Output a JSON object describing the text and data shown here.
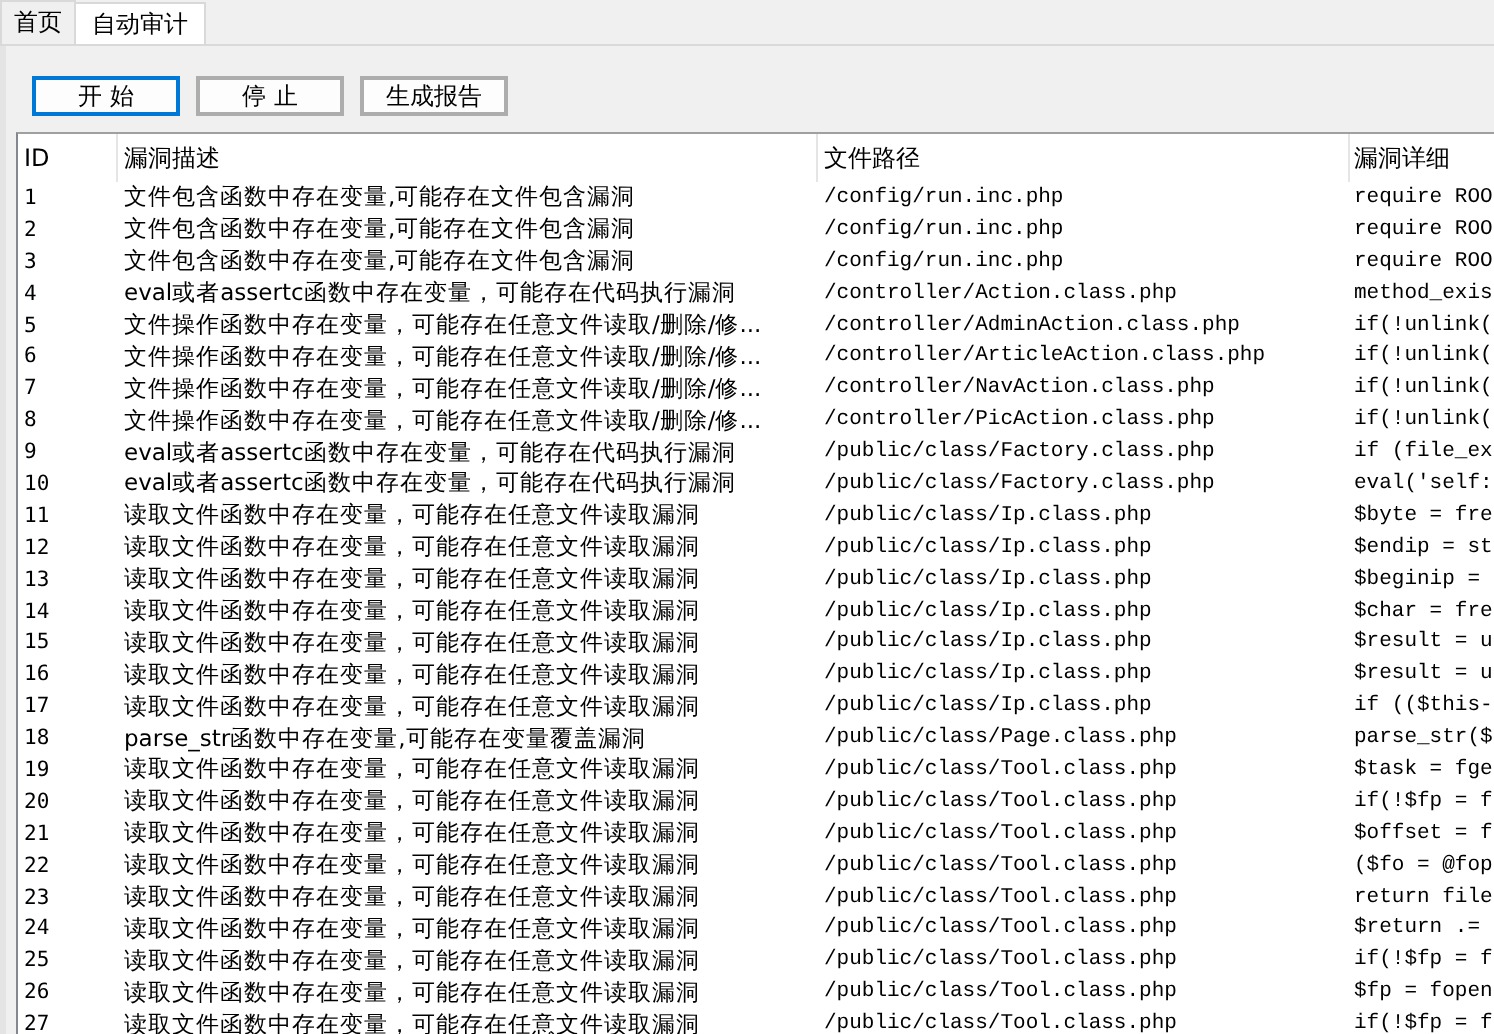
{
  "tabs": [
    {
      "label": "首页",
      "selected": false
    },
    {
      "label": "自动审计",
      "selected": true
    }
  ],
  "buttons": [
    {
      "label": "开 始",
      "selected": true
    },
    {
      "label": "停 止",
      "selected": false
    },
    {
      "label": "生成报告",
      "selected": false
    }
  ],
  "table": {
    "columns": [
      "ID",
      "漏洞描述",
      "文件路径",
      "漏洞详细"
    ],
    "rows": [
      [
        "1",
        "文件包含函数中存在变量,可能存在文件包含漏洞",
        "/config/run.inc.php",
        "require ROO"
      ],
      [
        "2",
        "文件包含函数中存在变量,可能存在文件包含漏洞",
        "/config/run.inc.php",
        "require ROO"
      ],
      [
        "3",
        "文件包含函数中存在变量,可能存在文件包含漏洞",
        "/config/run.inc.php",
        "require ROO"
      ],
      [
        "4",
        "eval或者assertc函数中存在变量，可能存在代码执行漏洞",
        "/controller/Action.class.php",
        "method_exis"
      ],
      [
        "5",
        "文件操作函数中存在变量，可能存在任意文件读取/删除/修...",
        "/controller/AdminAction.class.php",
        "if(!unlink("
      ],
      [
        "6",
        "文件操作函数中存在变量，可能存在任意文件读取/删除/修...",
        "/controller/ArticleAction.class.php",
        "if(!unlink("
      ],
      [
        "7",
        "文件操作函数中存在变量，可能存在任意文件读取/删除/修...",
        "/controller/NavAction.class.php",
        "if(!unlink("
      ],
      [
        "8",
        "文件操作函数中存在变量，可能存在任意文件读取/删除/修...",
        "/controller/PicAction.class.php",
        "if(!unlink("
      ],
      [
        "9",
        "eval或者assertc函数中存在变量，可能存在代码执行漏洞",
        "/public/class/Factory.class.php",
        "if (file_ex"
      ],
      [
        "10",
        "eval或者assertc函数中存在变量，可能存在代码执行漏洞",
        "/public/class/Factory.class.php",
        "eval('self:"
      ],
      [
        "11",
        "读取文件函数中存在变量，可能存在任意文件读取漏洞",
        "/public/class/Ip.class.php",
        "$byte = fre"
      ],
      [
        "12",
        "读取文件函数中存在变量，可能存在任意文件读取漏洞",
        "/public/class/Ip.class.php",
        "$endip = st"
      ],
      [
        "13",
        "读取文件函数中存在变量，可能存在任意文件读取漏洞",
        "/public/class/Ip.class.php",
        "$beginip ="
      ],
      [
        "14",
        "读取文件函数中存在变量，可能存在任意文件读取漏洞",
        "/public/class/Ip.class.php",
        "$char = fre"
      ],
      [
        "15",
        "读取文件函数中存在变量，可能存在任意文件读取漏洞",
        "/public/class/Ip.class.php",
        "$result = u"
      ],
      [
        "16",
        "读取文件函数中存在变量，可能存在任意文件读取漏洞",
        "/public/class/Ip.class.php",
        "$result = u"
      ],
      [
        "17",
        "读取文件函数中存在变量，可能存在任意文件读取漏洞",
        "/public/class/Ip.class.php",
        "if (($this-"
      ],
      [
        "18",
        "parse_str函数中存在变量,可能存在变量覆盖漏洞",
        "/public/class/Page.class.php",
        "parse_str($"
      ],
      [
        "19",
        "读取文件函数中存在变量，可能存在任意文件读取漏洞",
        "/public/class/Tool.class.php",
        "$task = fge"
      ],
      [
        "20",
        "读取文件函数中存在变量，可能存在任意文件读取漏洞",
        "/public/class/Tool.class.php",
        "if(!$fp = f"
      ],
      [
        "21",
        "读取文件函数中存在变量，可能存在任意文件读取漏洞",
        "/public/class/Tool.class.php",
        "$offset = f"
      ],
      [
        "22",
        "读取文件函数中存在变量，可能存在任意文件读取漏洞",
        "/public/class/Tool.class.php",
        "($fo = @fop"
      ],
      [
        "23",
        "读取文件函数中存在变量，可能存在任意文件读取漏洞",
        "/public/class/Tool.class.php",
        "return file"
      ],
      [
        "24",
        "读取文件函数中存在变量，可能存在任意文件读取漏洞",
        "/public/class/Tool.class.php",
        "$return .="
      ],
      [
        "25",
        "读取文件函数中存在变量，可能存在任意文件读取漏洞",
        "/public/class/Tool.class.php",
        "if(!$fp = f"
      ],
      [
        "26",
        "读取文件函数中存在变量，可能存在任意文件读取漏洞",
        "/public/class/Tool.class.php",
        "$fp = fopen"
      ],
      [
        "27",
        "读取文件函数中存在变量，可能存在任意文件读取漏洞",
        "/public/class/Tool.class.php",
        "if(!$fp = f"
      ]
    ]
  }
}
